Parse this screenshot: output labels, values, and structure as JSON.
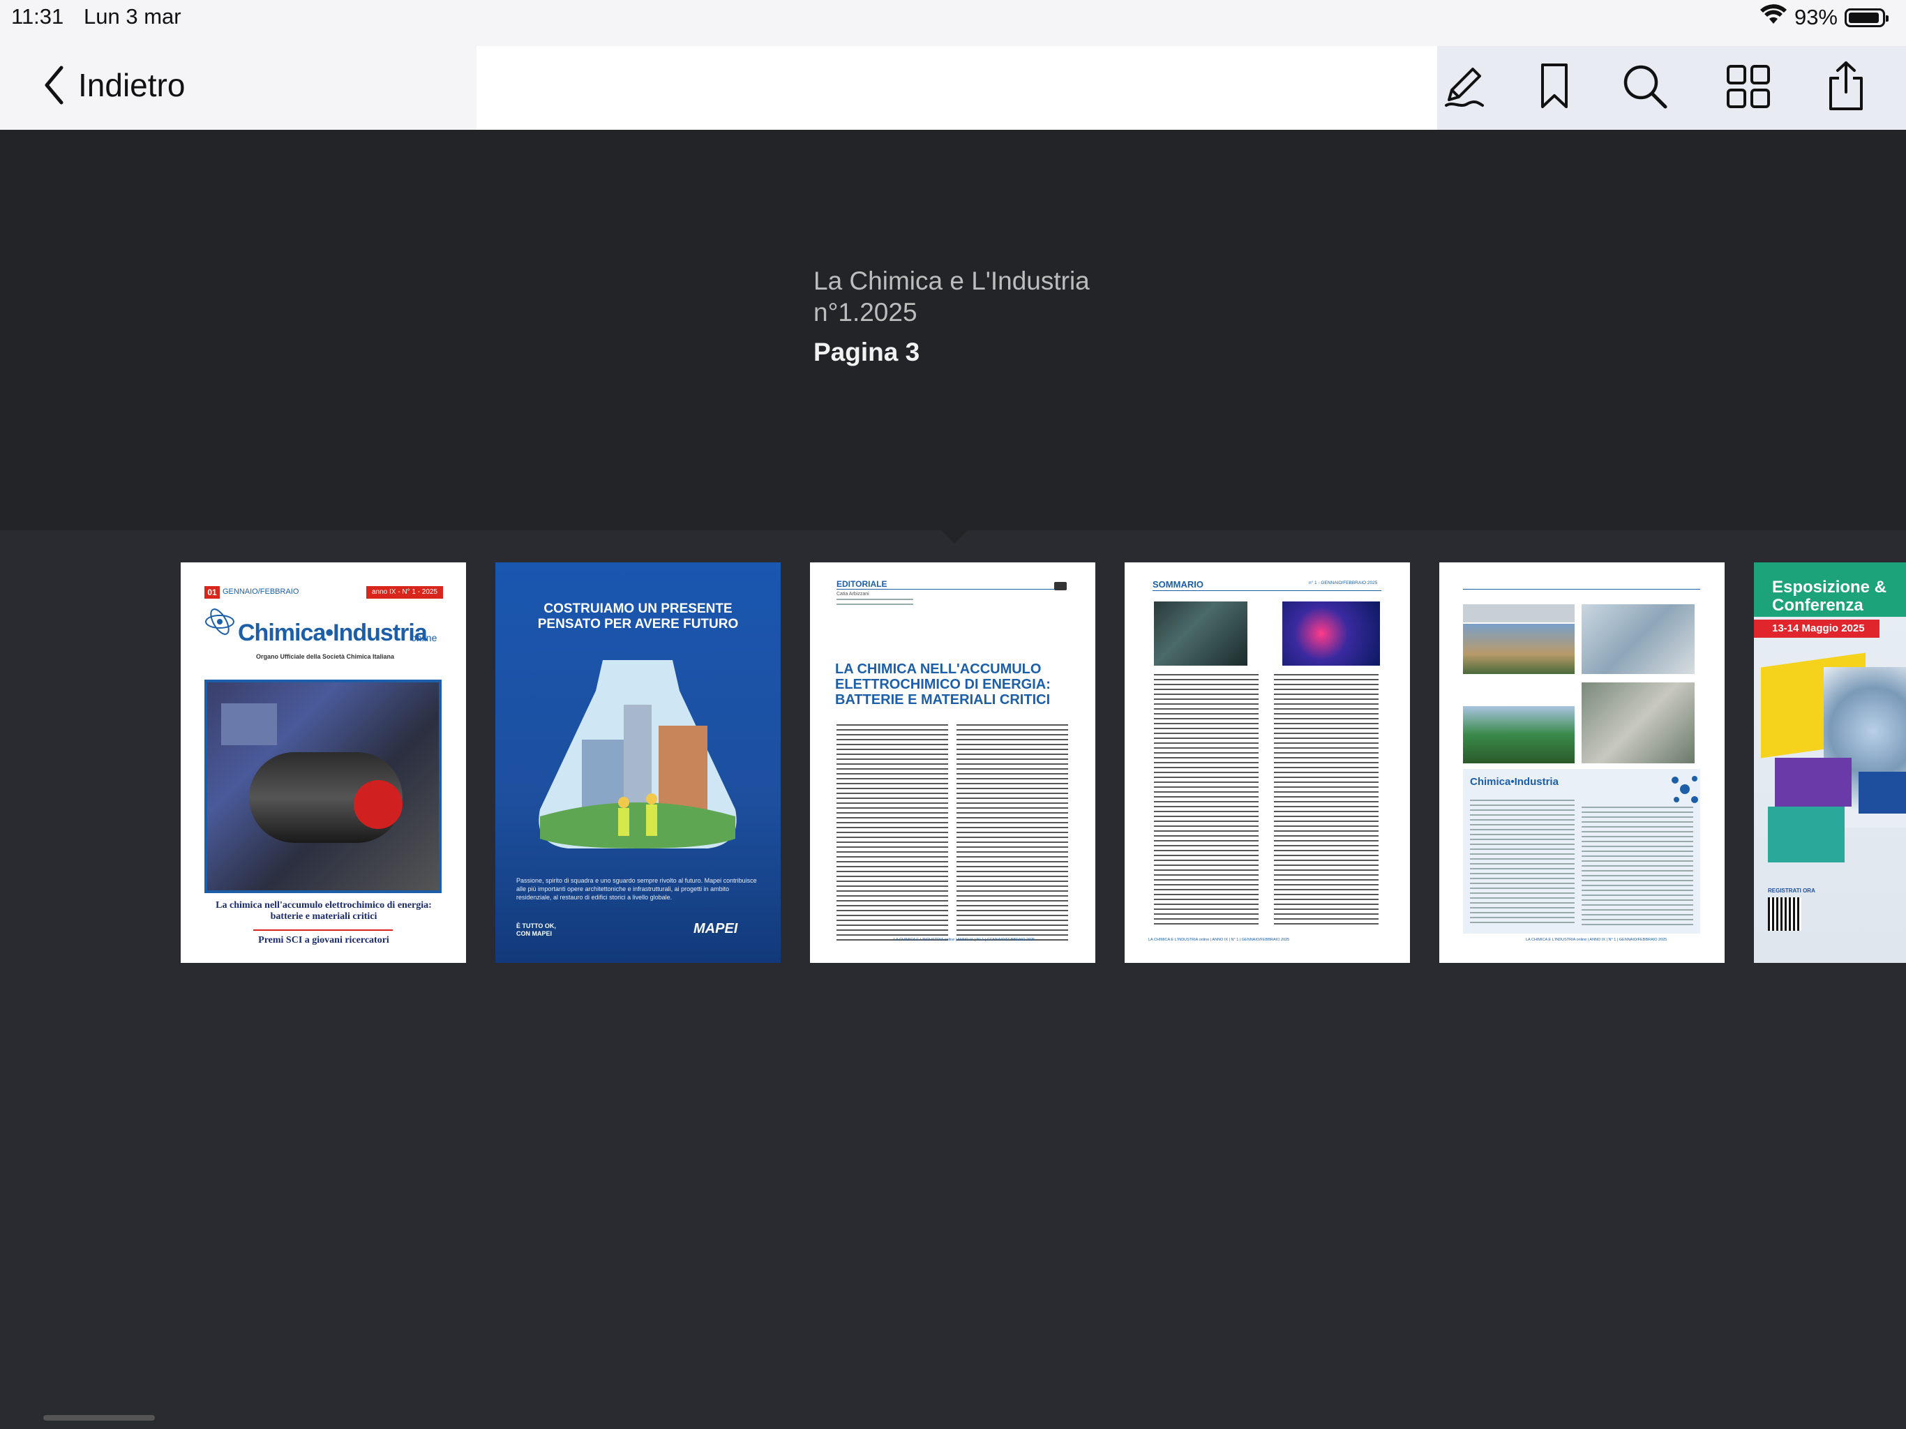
{
  "status_bar": {
    "time": "11:31",
    "date": "Lun 3 mar",
    "battery": "93%",
    "battery_level": 0.93
  },
  "nav": {
    "back_label": "Indietro",
    "tools": [
      "markup-icon",
      "bookmark-icon",
      "search-icon",
      "grid-icon",
      "share-icon"
    ]
  },
  "document": {
    "title": "La Chimica e L'Industria n°1.2025",
    "page_label": "Pagina 3"
  },
  "thumbnails": {
    "cover": {
      "issue_no": "01",
      "period": "GENNAIO/FEBBRAIO",
      "volume": "anno IX - N° 1 - 2025",
      "logo": "Chimica•Industria",
      "logo_suffix": "online",
      "tagline": "Organo Ufficiale della Società Chimica Italiana",
      "headline": "La chimica nell'accumulo elettrochimico di energia: batterie e materiali critici",
      "subheadline": "Premi SCI a giovani ricercatori"
    },
    "ad": {
      "headline_line1": "COSTRUIAMO UN PRESENTE",
      "headline_line2": "PENSATO PER AVERE FUTURO",
      "body": "Passione, spirito di squadra e uno sguardo sempre rivolto al futuro. Mapei contribuisce alle più importanti opere architettoniche e infrastrutturali, ai progetti in ambito residenziale, al restauro di edifici storici a livello globale.",
      "tagline": "È TUTTO OK, CON MAPEI",
      "brand": "MAPEI"
    },
    "editorial": {
      "section": "EDITORIALE",
      "author": "Catia Arbizzani",
      "title": "LA CHIMICA NELL'ACCUMULO ELETTROCHIMICO DI ENERGIA: BATTERIE E MATERIALI CRITICI",
      "footer": "LA CHIMICA E L'INDUSTRIA online | ANNO IX | N° 1 | GENNAIO/FEBBRAIO 2025"
    },
    "sommario": {
      "section": "SOMMARIO",
      "issue": "n° 1 - GENNAIO/FEBBRAIO 2025",
      "footer": "LA CHIMICA E L'INDUSTRIA online | ANNO IX | N° 1 | GENNAIO/FEBBRAIO 2025"
    },
    "masthead": {
      "logo": "Chimica•Industria",
      "footer": "LA CHIMICA E L'INDUSTRIA online | ANNO IX | N° 1 | GENNAIO/FEBBRAIO 2025"
    },
    "expo": {
      "title_line1": "Esposizione &",
      "title_line2": "Conferenza",
      "dates": "13-14 Maggio 2025",
      "cta": "REGISTRATI ORA"
    }
  },
  "colors": {
    "dark_bg": "#2a2b30",
    "header_bg": "#222428",
    "toolbar_bg": "#e8ebf2",
    "accent_blue": "#1c5fa8",
    "accent_red": "#d9261c",
    "mapei_blue": "#1d4f9e"
  }
}
